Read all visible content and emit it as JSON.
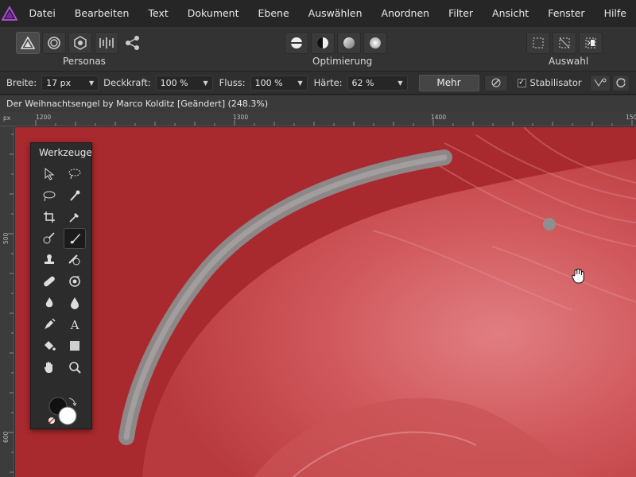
{
  "menu": {
    "items": [
      "Datei",
      "Bearbeiten",
      "Text",
      "Dokument",
      "Ebene",
      "Auswählen",
      "Anordnen",
      "Filter",
      "Ansicht",
      "Fenster",
      "Hilfe"
    ]
  },
  "toolbar": {
    "personas_label": "Personas",
    "optimierung_label": "Optimierung",
    "auswahl_label": "Auswahl"
  },
  "context": {
    "breite_label": "Breite:",
    "breite_value": "17 px",
    "deckkraft_label": "Deckkraft:",
    "deckkraft_value": "100 %",
    "fluss_label": "Fluss:",
    "fluss_value": "100 %",
    "haerte_label": "Härte:",
    "haerte_value": "62 %",
    "mehr_label": "Mehr",
    "stabilisator_label": "Stabilisator"
  },
  "document": {
    "title": "Der Weihnachtsengel by Marco Kolditz [Geändert] (248.3%)"
  },
  "rulers": {
    "unit": "px",
    "top": [
      "1200",
      "1300",
      "1400",
      "150"
    ],
    "left": [
      "500",
      "600"
    ]
  },
  "tools_panel": {
    "title": "Werkzeuge"
  },
  "colors": {
    "accent": "#a33cc7",
    "mask_overlay": "#b83a3e",
    "primary_color": "#111111",
    "secondary_color": "#ffffff"
  }
}
